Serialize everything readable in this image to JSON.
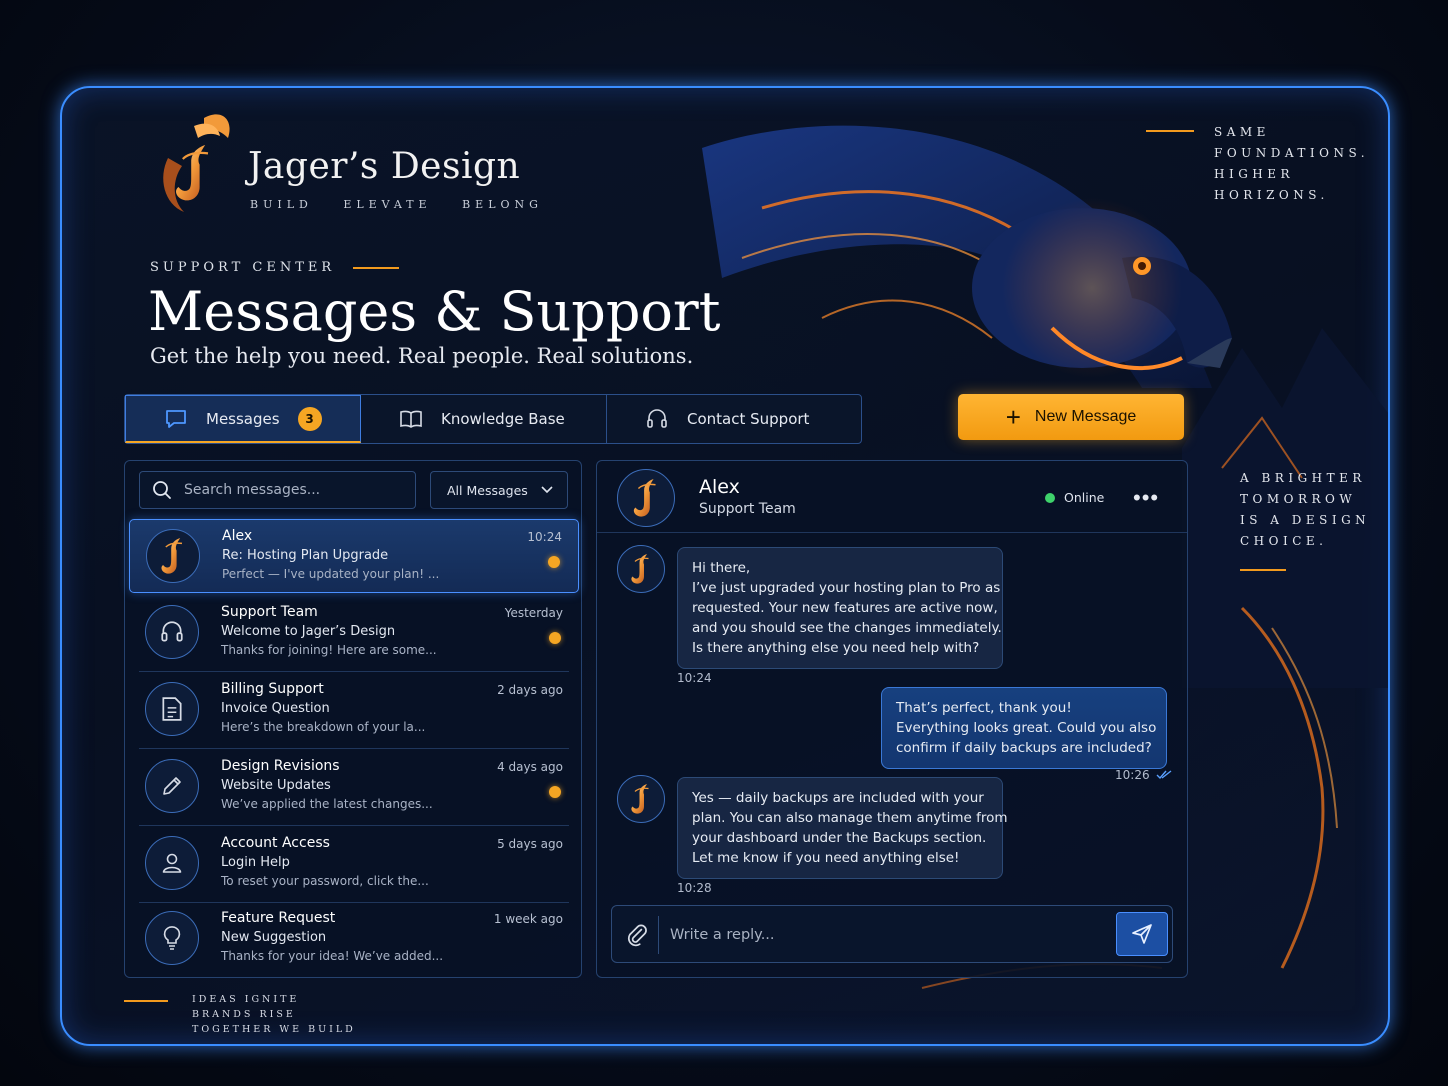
{
  "brand": {
    "name": "Jager’s Design",
    "tagline": "BUILD ELEVATE BELONG"
  },
  "hero": {
    "eyebrow": "SUPPORT CENTER",
    "title": "Messages & Support",
    "subtitle": "Get the help you need. Real people. Real solutions."
  },
  "quotes": {
    "top_right": [
      "SAME",
      "FOUNDATIONS.",
      "HIGHER",
      "HORIZONS."
    ],
    "right": [
      "A BRIGHTER",
      "TOMORROW",
      "IS A DESIGN",
      "CHOICE."
    ],
    "bottom_left": [
      "IDEAS IGNITE",
      "BRANDS RISE",
      "TOGETHER WE BUILD"
    ]
  },
  "tabs": [
    {
      "label": "Messages",
      "badge": "3",
      "icon": "chat-bubble-icon"
    },
    {
      "label": "Knowledge Base",
      "icon": "book-icon"
    },
    {
      "label": "Contact Support",
      "icon": "headset-icon"
    }
  ],
  "new_message_label": "New Message",
  "search": {
    "placeholder": "Search messages..."
  },
  "filter": {
    "selected": "All Messages"
  },
  "conversations": [
    {
      "name": "Alex",
      "subject": "Re: Hosting Plan Upgrade",
      "preview": "Perfect — I've updated your plan! ...",
      "time": "10:24",
      "unread": true,
      "icon": "logo-avatar"
    },
    {
      "name": "Support Team",
      "subject": "Welcome to Jager’s Design",
      "preview": "Thanks for joining! Here are some...",
      "time": "Yesterday",
      "unread": true,
      "icon": "headset-icon"
    },
    {
      "name": "Billing Support",
      "subject": "Invoice Question",
      "preview": "Here’s the breakdown of your la...",
      "time": "2 days ago",
      "unread": false,
      "icon": "document-icon"
    },
    {
      "name": "Design Revisions",
      "subject": "Website Updates",
      "preview": "We’ve applied the latest changes...",
      "time": "4 days ago",
      "unread": true,
      "icon": "pencil-icon"
    },
    {
      "name": "Account Access",
      "subject": "Login Help",
      "preview": "To reset your password, click the...",
      "time": "5 days ago",
      "unread": false,
      "icon": "user-icon"
    },
    {
      "name": "Feature Request",
      "subject": "New Suggestion",
      "preview": "Thanks for your idea! We’ve added...",
      "time": "1 week ago",
      "unread": false,
      "icon": "lightbulb-icon"
    }
  ],
  "chat": {
    "contact_name": "Alex",
    "contact_role": "Support Team",
    "status": "Online",
    "messages": [
      {
        "from": "agent",
        "lines": [
          "Hi there,",
          "I’ve just upgraded your hosting plan to Pro as",
          "requested. Your new features are active now,",
          "and you should see the changes immediately.",
          "Is there anything else you need help with?"
        ],
        "time": "10:24"
      },
      {
        "from": "user",
        "lines": [
          "That’s perfect, thank you!",
          "Everything looks great. Could you also",
          "confirm if daily backups are included?"
        ],
        "time": "10:26"
      },
      {
        "from": "agent",
        "lines": [
          "Yes — daily backups are included with your",
          "plan. You can also manage them anytime from",
          "your dashboard under the Backups section.",
          "Let me know if you need anything else!"
        ],
        "time": "10:28"
      }
    ],
    "reply_placeholder": "Write a reply..."
  },
  "colors": {
    "accent": "#f5a623",
    "frame_glow": "#3a8dff",
    "online": "#3ed26b"
  }
}
